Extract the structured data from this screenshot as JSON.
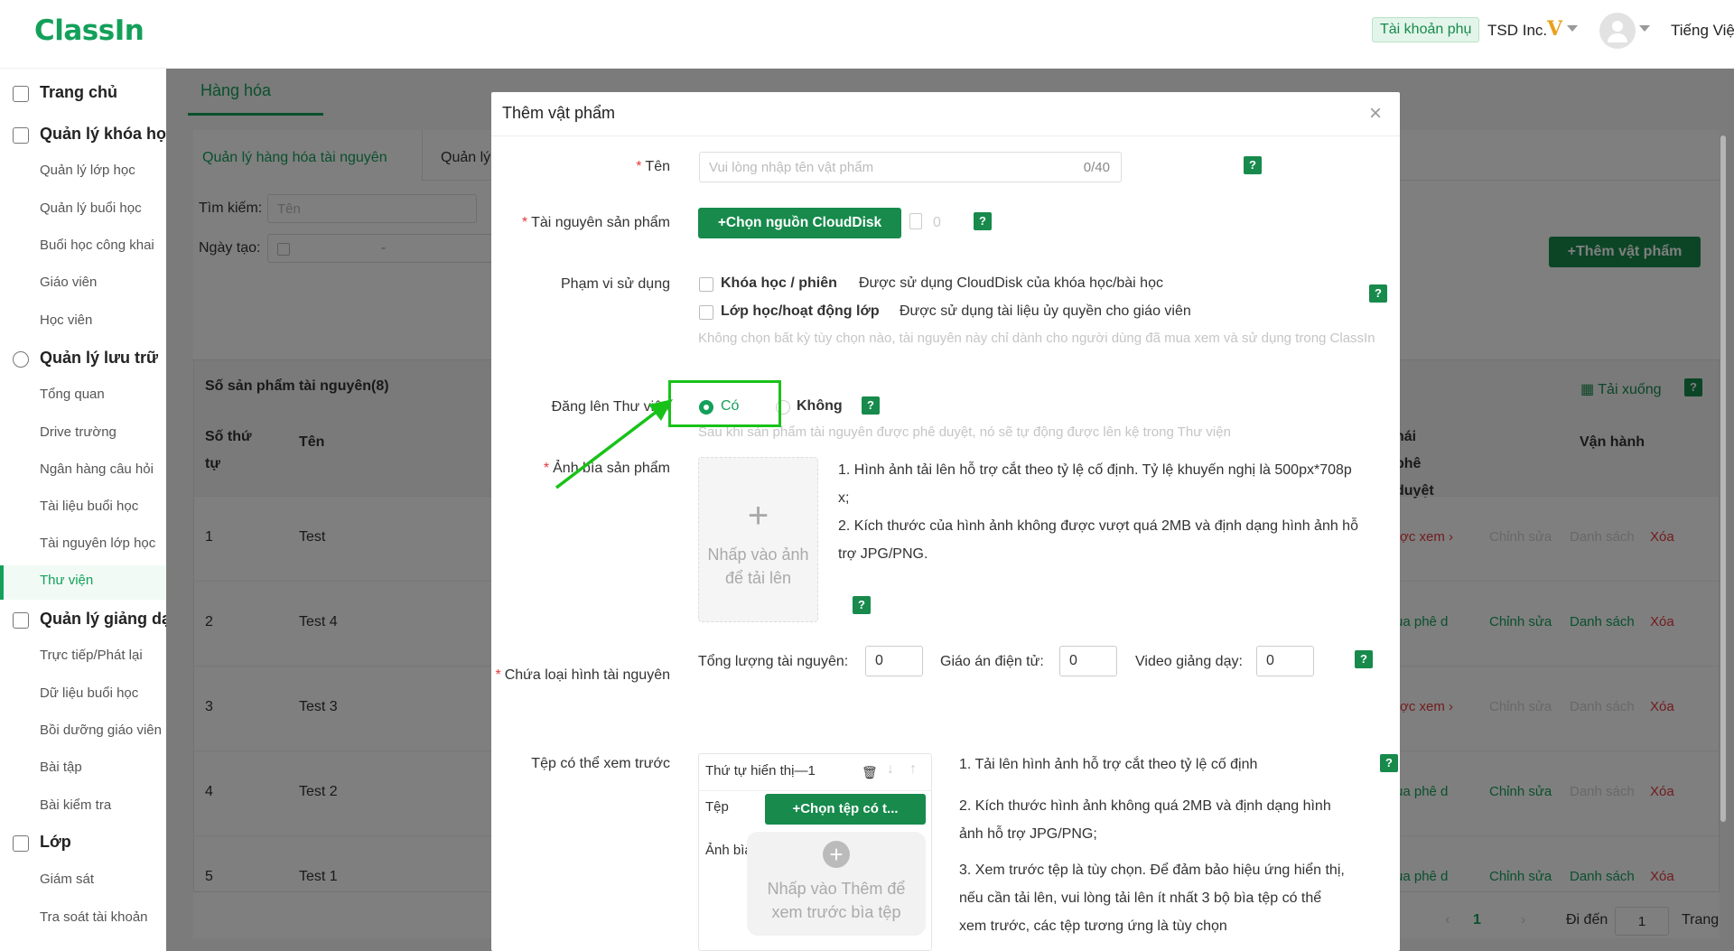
{
  "header": {
    "logo": "ClassIn",
    "sub_account_badge": "Tài khoản phụ",
    "org_name": "TSD Inc.",
    "vip_mark": "V",
    "language": "Tiếng Việt"
  },
  "sidebar": {
    "groups": [
      {
        "label": "Trang chủ",
        "icon": "home-icon",
        "items": []
      },
      {
        "label": "Quản lý khóa học",
        "icon": "course-icon",
        "items": [
          "Quản lý lớp học",
          "Quản lý buổi học",
          "Buổi học công khai",
          "Giáo viên",
          "Học viên"
        ]
      },
      {
        "label": "Quản lý lưu trữ",
        "icon": "cloud-icon",
        "items": [
          "Tổng quan",
          "Drive trường",
          "Ngân hàng câu hỏi",
          "Tài liệu buổi học",
          "Tài nguyên lớp học",
          "Thư viện"
        ]
      },
      {
        "label": "Quản lý giảng dạy",
        "icon": "teaching-icon",
        "items": [
          "Trực tiếp/Phát lại",
          "Dữ liệu buổi học",
          "Bồi dưỡng giáo viên",
          "Bài tập",
          "Bài kiểm tra"
        ]
      },
      {
        "label": "Lớp",
        "icon": "class-icon",
        "items": [
          "Giám sát",
          "Tra soát tài khoản"
        ]
      }
    ],
    "active_item": "Thư viện"
  },
  "page": {
    "tab": "Hàng hóa",
    "subtabs": [
      "Quản lý hàng hóa tài nguyên",
      "Quản lý"
    ],
    "search_label": "Tìm kiếm:",
    "search_placeholder": "Tên",
    "date_label": "Ngày tạo:",
    "date_sep": "-",
    "add_button": "+Thêm vật phẩm",
    "table_title": "Số sản phẩm tài nguyên(8)",
    "download": "Tải xuống",
    "columns": {
      "index": "Số thứ tự",
      "name": "Tên",
      "approval": "hái phê duyệt",
      "ops": "Vận hành"
    },
    "rows": [
      {
        "index": "1",
        "name": "Test",
        "status": "rợc xem ›",
        "status_color": "#e4393c",
        "edit": "Chỉnh sửa",
        "list": "Danh sách",
        "del": "Xóa",
        "edit_enabled": false,
        "list_enabled": false
      },
      {
        "index": "2",
        "name": "Test 4",
        "status": "ua phê d",
        "status_color": "#14a05a",
        "edit": "Chỉnh sửa",
        "list": "Danh sách",
        "del": "Xóa",
        "edit_enabled": true,
        "list_enabled": true
      },
      {
        "index": "3",
        "name": "Test 3",
        "status": "rợc xem ›",
        "status_color": "#e4393c",
        "edit": "Chỉnh sửa",
        "list": "Danh sách",
        "del": "Xóa",
        "edit_enabled": false,
        "list_enabled": false
      },
      {
        "index": "4",
        "name": "Test 2",
        "status": "ua phê d",
        "status_color": "#14a05a",
        "edit": "Chỉnh sửa",
        "list": "Danh sách",
        "del": "Xóa",
        "edit_enabled": true,
        "list_enabled": false
      },
      {
        "index": "5",
        "name": "Test 1",
        "status": "ua phê d",
        "status_color": "#14a05a",
        "edit": "Chỉnh sửa",
        "list": "Danh sách",
        "del": "Xóa",
        "edit_enabled": true,
        "list_enabled": true
      }
    ],
    "pagination": {
      "current": "1",
      "goto_label": "Đi đến",
      "goto_value": "1",
      "page_word": "Trang"
    }
  },
  "modal": {
    "title": "Thêm vật phẩm",
    "close": "×",
    "name_label": "Tên",
    "name_placeholder": "Vui lòng nhập tên vật phẩm",
    "name_count": "0/40",
    "resource_label": "Tài nguyên sản phẩm",
    "resource_button": "+Chọn nguồn CloudDisk",
    "resource_count": "0",
    "scope_label": "Phạm vi sử dụng",
    "scope_opt1": "Khóa học / phiên",
    "scope_opt1_desc": "Được sử dụng CloudDisk của khóa học/bài học",
    "scope_opt2": "Lớp học/hoạt động lớp",
    "scope_opt2_desc": "Được sử dụng tài liệu ủy quyền cho giáo viên",
    "scope_hint": "Không chọn bất kỳ tùy chọn nào, tài nguyên này chỉ dành cho người dùng đã mua xem và sử dụng trong ClassIn",
    "publish_label": "Đăng lên Thư viện",
    "publish_yes": "Có",
    "publish_no": "Không",
    "publish_hint": "Sau khi sản phẩm tài nguyên được phê duyệt, nó sẽ tự động được lên kệ trong Thư viện",
    "cover_label": "Ảnh bìa sản phẩm",
    "cover_upload": "Nhấp vào ảnh để tải lên",
    "cover_note1": "1. Hình ảnh tải lên hỗ trợ cắt theo tỷ lệ cố định. Tỷ lệ khuyến nghị là 500px*708px;",
    "cover_note2": "2. Kích thước của hình ảnh không được vượt quá 2MB và định dạng hình ảnh hỗ trợ JPG/PNG.",
    "type_label": "Chứa loại hình tài nguyên",
    "total_label": "Tổng lượng tài nguyên:",
    "total_value": "0",
    "lesson_label": "Giáo án điện tử:",
    "lesson_value": "0",
    "video_label": "Video giảng dạy:",
    "video_value": "0",
    "preview_label": "Tệp có thể xem trước",
    "preview_order": "Thứ tự hiển thị—1",
    "preview_file_label": "Tệp",
    "preview_file_button": "+Chọn tệp có t...",
    "preview_cover_label": "Ảnh bìa",
    "preview_cover_upload": "Nhấp vào Thêm để xem trước bìa tệp",
    "preview_note1": "1. Tải lên hình ảnh hỗ trợ cắt theo tỷ lệ cố định",
    "preview_note2": "2. Kích thước hình ảnh không quá 2MB và định dạng hình ảnh hỗ trợ JPG/PNG;",
    "preview_note3": "3. Xem trước tệp là tùy chọn. Để đảm bảo hiệu ứng hiển thị, nếu cần tải lên, vui lòng tải lên ít nhất 3 bộ bìa tệp có thể xem trước, các tệp tương ứng là tùy chọn",
    "help": "?"
  },
  "annotation": {
    "color": "#19c219"
  },
  "colors": {
    "brand": "#14a05a",
    "button": "#178a4c",
    "danger": "#e4393c"
  }
}
